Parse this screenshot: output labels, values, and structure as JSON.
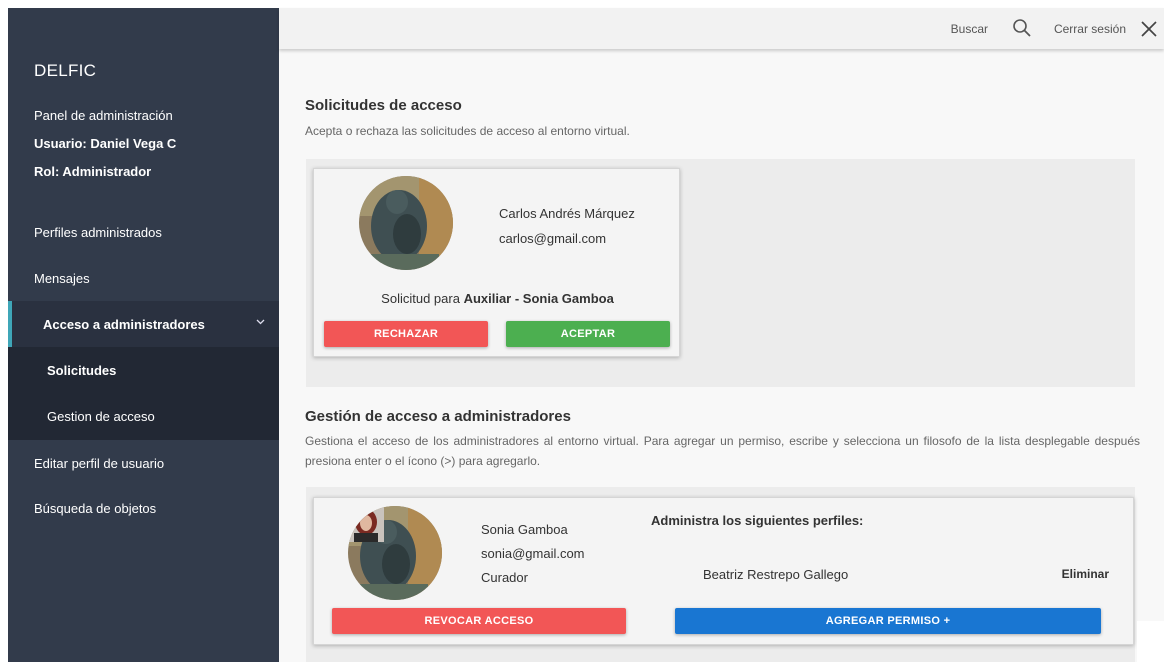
{
  "sidebar": {
    "brand": "DELFIC",
    "panel_label": "Panel de administración",
    "user_label": "Usuario: Daniel Vega C",
    "role_label": "Rol: Administrador",
    "items": [
      {
        "label": "Perfiles administrados"
      },
      {
        "label": "Mensajes"
      },
      {
        "label": "Acceso a administradores"
      },
      {
        "label": "Solicitudes"
      },
      {
        "label": "Gestion de acceso"
      },
      {
        "label": "Editar perfil de usuario"
      },
      {
        "label": "Búsqueda de objetos"
      }
    ],
    "accent_color": "#3fa6b8"
  },
  "topbar": {
    "search_label": "Buscar",
    "logout_label": "Cerrar sesión"
  },
  "requests": {
    "title": "Solicitudes de acceso",
    "description": "Acepta o rechaza las solicitudes de acceso al entorno virtual.",
    "card": {
      "name": "Carlos Andrés Márquez",
      "email": "carlos@gmail.com",
      "request_prefix": "Solicitud para ",
      "request_target": "Auxiliar - Sonia Gamboa",
      "reject_label": "RECHAZAR",
      "accept_label": "ACEPTAR"
    }
  },
  "access_management": {
    "title": "Gestión de acceso a administradores",
    "description": "Gestiona el acceso de los administradores al entorno virtual. Para agregar un permiso, escribe y selecciona un filosofo de la lista desplegable después presiona enter o el ícono (>) para agregarlo.",
    "card": {
      "name": "Sonia Gamboa",
      "email": "sonia@gmail.com",
      "role": "Curador",
      "profiles_heading": "Administra los siguientes perfiles:",
      "profiles": [
        {
          "name": "Beatriz Restrepo Gallego",
          "remove_label": "Eliminar"
        }
      ],
      "revoke_label": "REVOCAR ACCESO",
      "add_label": "AGREGAR PERMISO +"
    }
  },
  "colors": {
    "sidebar_bg": "#323b4b",
    "danger": "#f25656",
    "success": "#4caf50",
    "primary": "#1976d2"
  }
}
